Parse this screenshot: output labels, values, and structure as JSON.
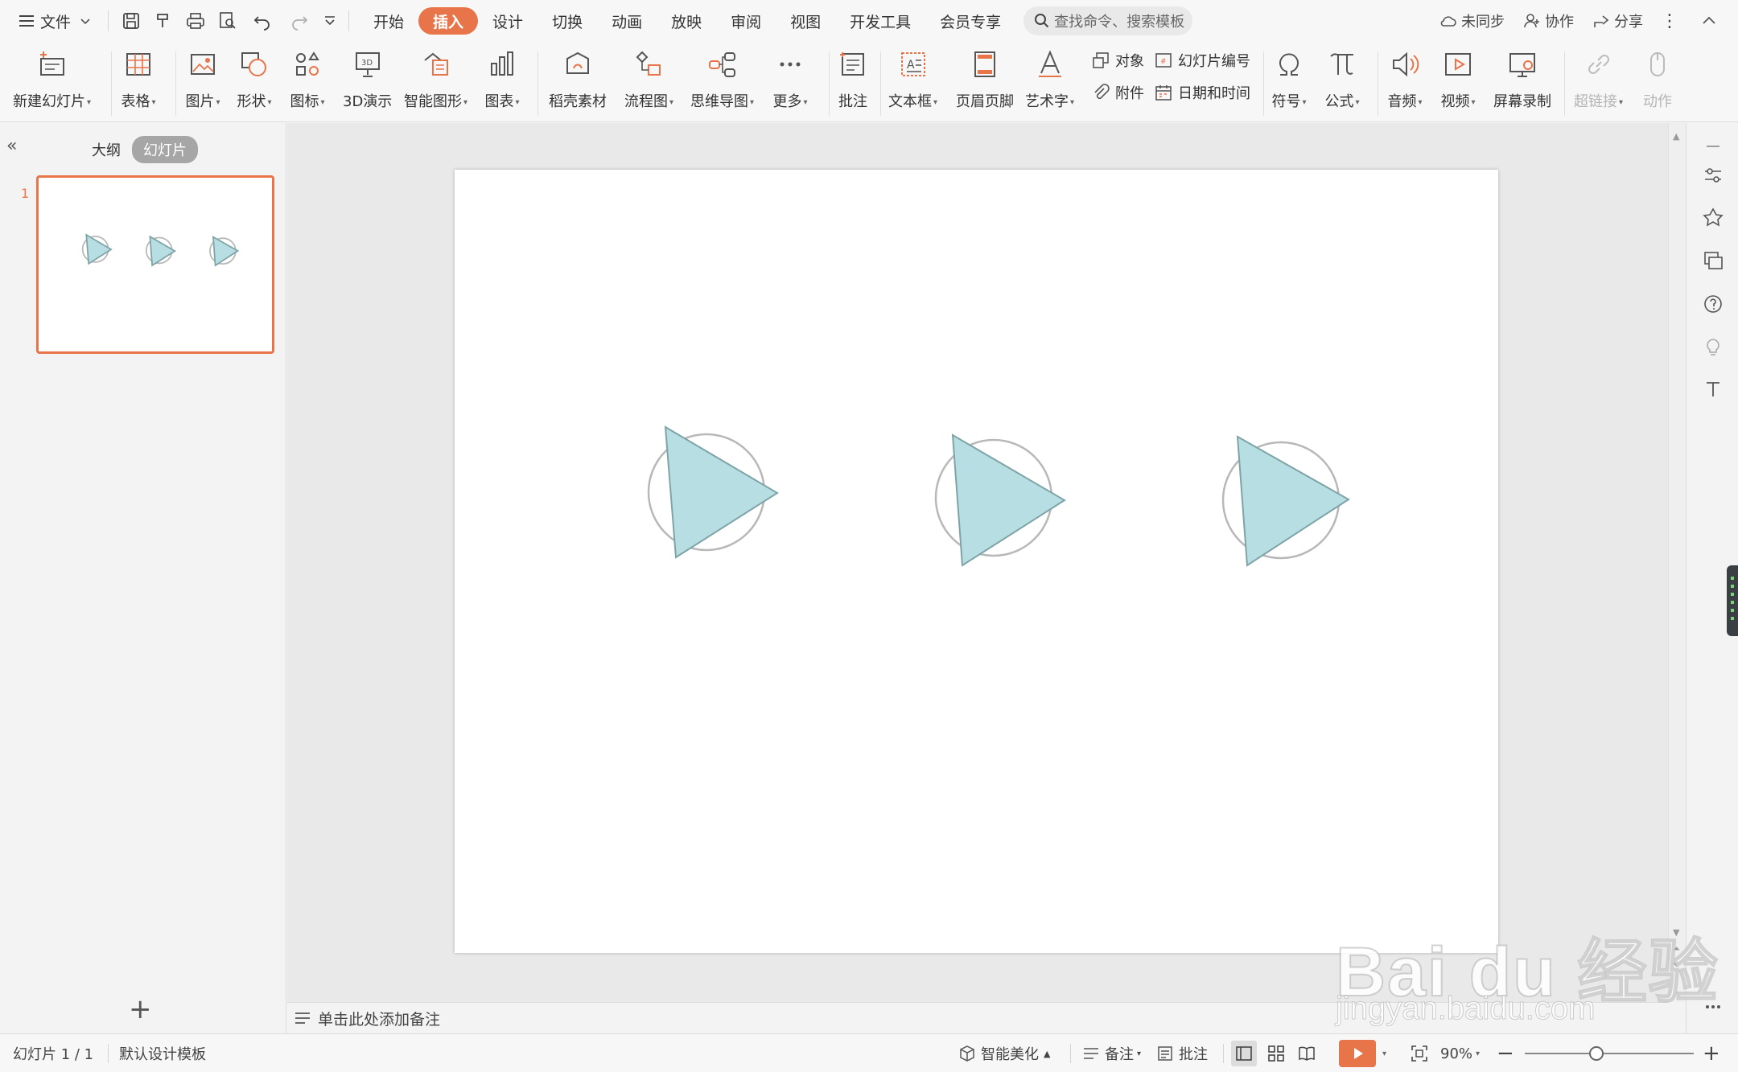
{
  "menubar": {
    "file_label": "文件",
    "tabs": [
      "开始",
      "插入",
      "设计",
      "切换",
      "动画",
      "放映",
      "审阅",
      "视图",
      "开发工具",
      "会员专享"
    ],
    "active_tab": "插入",
    "search_placeholder": "查找命令、搜索模板",
    "sync_label": "未同步",
    "collab_label": "协作",
    "share_label": "分享"
  },
  "ribbon": {
    "new_slide": "新建幻灯片",
    "table": "表格",
    "picture": "图片",
    "shape": "形状",
    "icon": "图标",
    "demo3d": "3D演示",
    "smart_graphic": "智能图形",
    "chart": "图表",
    "daoke": "稻壳素材",
    "flowchart": "流程图",
    "mindmap": "思维导图",
    "more": "更多",
    "comment": "批注",
    "textbox": "文本框",
    "header_footer": "页眉页脚",
    "wordart": "艺术字",
    "object": "对象",
    "slide_number": "幻灯片编号",
    "attachment": "附件",
    "date_time": "日期和时间",
    "symbol": "符号",
    "formula": "公式",
    "audio": "音频",
    "video": "视频",
    "screen_record": "屏幕录制",
    "hyperlink": "超链接",
    "action": "动作"
  },
  "left_panel": {
    "outline_tab": "大纲",
    "slides_tab": "幻灯片",
    "slide_number": "1"
  },
  "notes": {
    "placeholder": "单击此处添加备注"
  },
  "statusbar": {
    "slide_info": "幻灯片 1 / 1",
    "template": "默认设计模板",
    "smart_beautify": "智能美化",
    "notes": "备注",
    "comments": "批注",
    "zoom": "90%"
  },
  "watermark": {
    "line1": "Bai du 经验",
    "line2": "jingyan.baidu.com"
  },
  "colors": {
    "accent": "#e8744a",
    "triangle_fill": "#b7dee2",
    "triangle_stroke": "#7fa4a8",
    "circle_stroke": "#b8b8b8"
  }
}
